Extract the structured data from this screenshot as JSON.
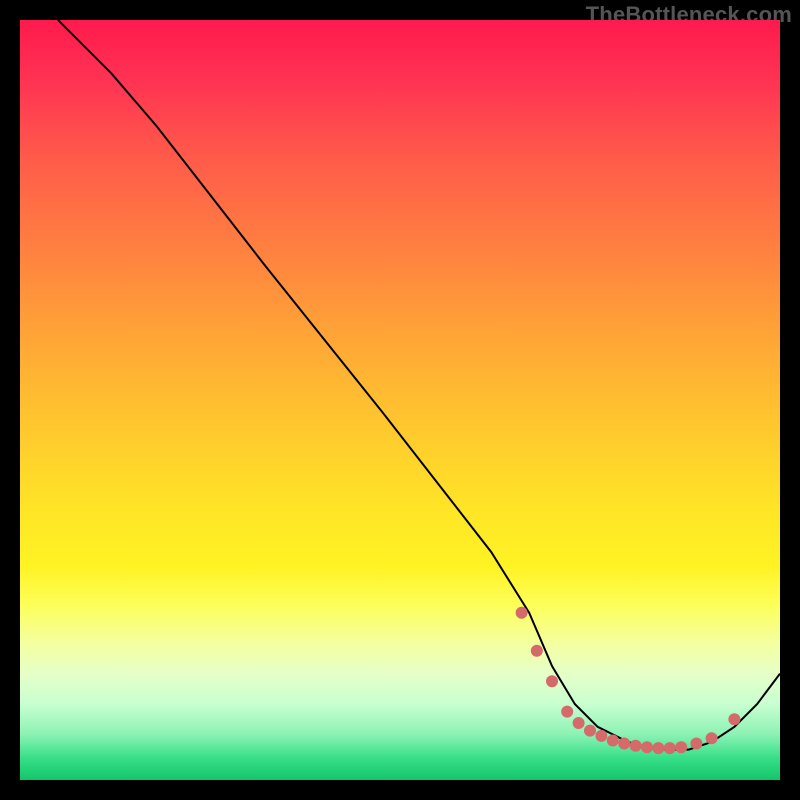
{
  "watermark": "TheBottleneck.com",
  "colors": {
    "background": "#000000",
    "curve": "#000000",
    "dot": "#d46a6a",
    "gradient_top": "#ff1a4d",
    "gradient_bottom": "#14c46a"
  },
  "chart_data": {
    "type": "line",
    "title": "",
    "xlabel": "",
    "ylabel": "",
    "xlim": [
      0,
      100
    ],
    "ylim": [
      0,
      100
    ],
    "grid": false,
    "legend": false,
    "curve": {
      "x": [
        5,
        8,
        12,
        18,
        25,
        32,
        40,
        48,
        55,
        62,
        67,
        70,
        73,
        76,
        80,
        84,
        88,
        91,
        94,
        97,
        100
      ],
      "y": [
        100,
        97,
        93,
        86,
        77,
        68,
        58,
        48,
        39,
        30,
        22,
        15,
        10,
        7,
        5,
        4,
        4,
        5,
        7,
        10,
        14
      ]
    },
    "dots": {
      "x": [
        66,
        68,
        70,
        72,
        73.5,
        75,
        76.5,
        78,
        79.5,
        81,
        82.5,
        84,
        85.5,
        87,
        89,
        91,
        94
      ],
      "y": [
        22,
        17,
        13,
        9,
        7.5,
        6.5,
        5.8,
        5.2,
        4.8,
        4.5,
        4.3,
        4.2,
        4.2,
        4.3,
        4.8,
        5.5,
        8
      ]
    }
  }
}
